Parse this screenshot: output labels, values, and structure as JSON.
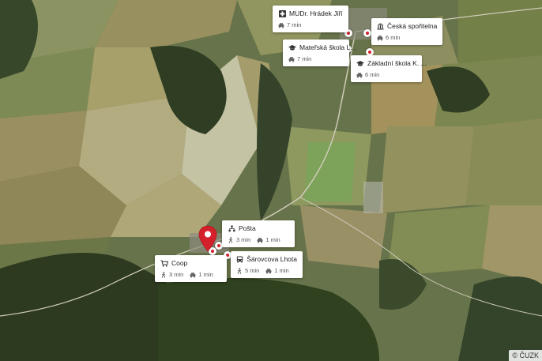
{
  "map": {
    "attribution": "© ČUZK"
  },
  "pois": [
    {
      "name": "MUDr. Hrádek Jiří",
      "icon": "medical-cross-icon",
      "walk": "",
      "drive": "7 min"
    },
    {
      "name": "Česká spořitelna",
      "icon": "bank-icon",
      "walk": "",
      "drive": "6 min"
    },
    {
      "name": "Mateřská škola L...",
      "icon": "school-icon",
      "walk": "",
      "drive": "7 min"
    },
    {
      "name": "Základní škola K. ...",
      "icon": "school-icon",
      "walk": "",
      "drive": "6 min"
    },
    {
      "name": "Pošta",
      "icon": "post-office-icon",
      "walk": "3 min",
      "drive": "1 min"
    },
    {
      "name": "Coop",
      "icon": "shopping-cart-icon",
      "walk": "3 min",
      "drive": "1 min"
    },
    {
      "name": "Šárovcova Lhota",
      "icon": "bus-icon",
      "walk": "5 min",
      "drive": "1 min"
    }
  ],
  "colors": {
    "pin": "#d3202b",
    "card": "#ffffff"
  }
}
